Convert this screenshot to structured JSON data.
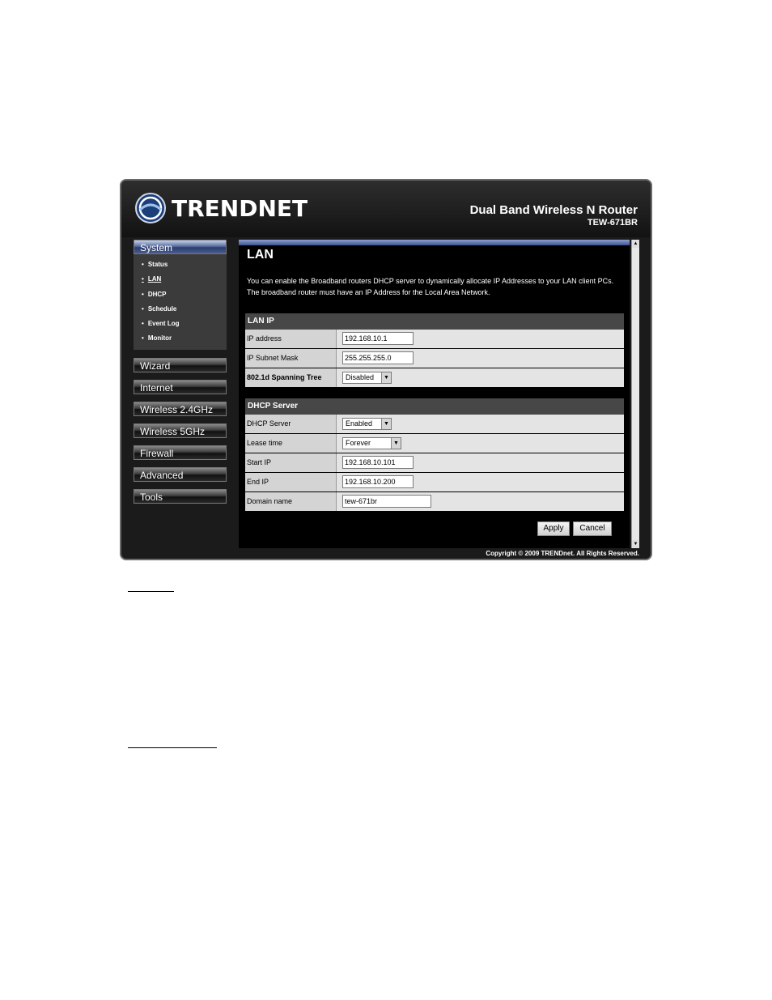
{
  "brand": {
    "logo_text": "TRENDNET",
    "product_name": "Dual Band Wireless N Router",
    "model": "TEW-671BR"
  },
  "sidebar": {
    "system": {
      "label": "System",
      "items": [
        {
          "label": "Status"
        },
        {
          "label": "LAN"
        },
        {
          "label": "DHCP"
        },
        {
          "label": "Schedule"
        },
        {
          "label": "Event Log"
        },
        {
          "label": "Monitor"
        }
      ]
    },
    "menus": [
      {
        "label": "Wizard"
      },
      {
        "label": "Internet"
      },
      {
        "label": "Wireless 2.4GHz"
      },
      {
        "label": "Wireless 5GHz"
      },
      {
        "label": "Firewall"
      },
      {
        "label": "Advanced"
      },
      {
        "label": "Tools"
      }
    ],
    "bullet": "•"
  },
  "main": {
    "title": "LAN",
    "description": "You can enable the Broadband routers DHCP server to dynamically allocate IP Addresses to your LAN client PCs. The broadband router must have an IP Address for the Local Area Network.",
    "lan_ip": {
      "heading": "LAN IP",
      "ip_label": "IP address",
      "ip_value": "192.168.10.1",
      "mask_label": "IP Subnet Mask",
      "mask_value": "255.255.255.0",
      "stp_label": "802.1d Spanning Tree",
      "stp_value": "Disabled"
    },
    "dhcp": {
      "heading": "DHCP Server",
      "server_label": "DHCP Server",
      "server_value": "Enabled",
      "lease_label": "Lease time",
      "lease_value": "Forever",
      "start_label": "Start IP",
      "start_value": "192.168.10.101",
      "end_label": "End IP",
      "end_value": "192.168.10.200",
      "domain_label": "Domain name",
      "domain_value": "tew-671br"
    },
    "apply_label": "Apply",
    "cancel_label": "Cancel"
  },
  "footer": {
    "copyright": "Copyright © 2009 TRENDnet. All Rights Reserved."
  },
  "icons": {
    "dropdown_arrow": "▼",
    "scroll_up": "▲",
    "scroll_down": "▼"
  }
}
